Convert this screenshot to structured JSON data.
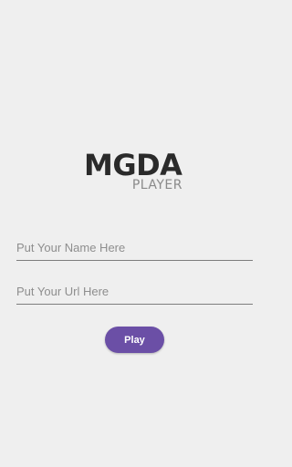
{
  "logo": {
    "title": "MGDA",
    "subtitle": "PLAYER"
  },
  "form": {
    "name_placeholder": "Put Your Name Here",
    "name_value": "",
    "url_placeholder": "Put Your Url Here",
    "url_value": "",
    "play_label": "Play"
  },
  "colors": {
    "background": "#efefef",
    "accent": "#6b4fa6",
    "logo_text": "#2a2a2a",
    "logo_subtitle": "#8a8a8a"
  }
}
